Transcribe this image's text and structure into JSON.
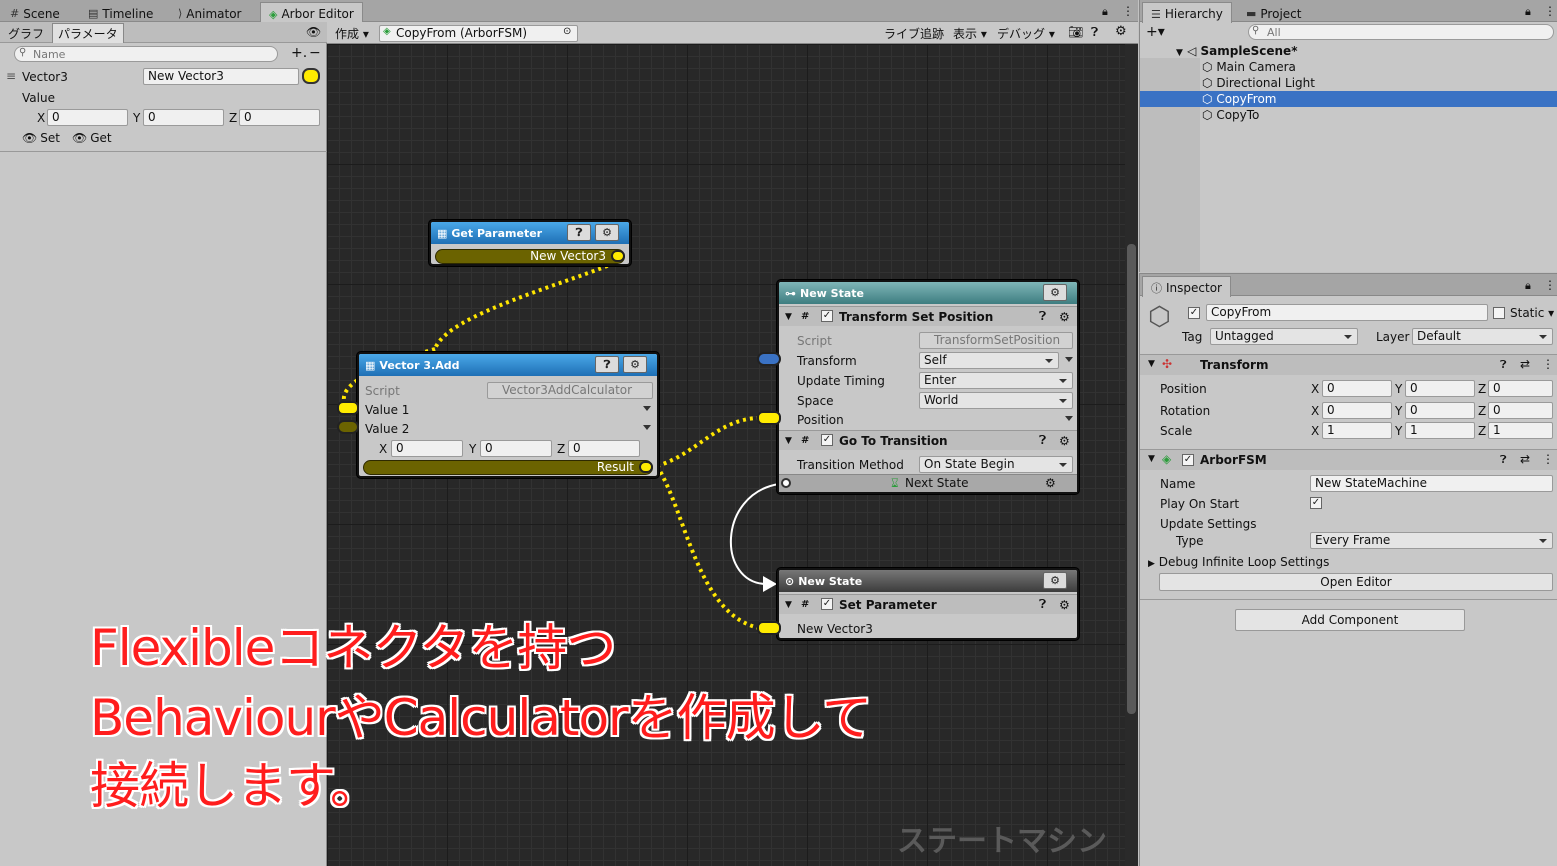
{
  "editor_tabs": [
    "Scene",
    "Timeline",
    "Animator",
    "Arbor Editor"
  ],
  "left_panel": {
    "sub_tabs": [
      "グラフ",
      "パラメータ"
    ],
    "search_placeholder": "Name",
    "param": {
      "type_label": "Vector3",
      "name_value": "New Vector3",
      "value_label": "Value",
      "x_label": "X",
      "x": "0",
      "y_label": "Y",
      "y": "0",
      "z_label": "Z",
      "z": "0"
    },
    "set_label": "Set",
    "get_label": "Get"
  },
  "graph_toolbar": {
    "create_label": "作成",
    "object_field": "CopyFrom (ArborFSM)",
    "live_tracking": "ライブ追跡",
    "view": "表示",
    "debug": "デバッグ"
  },
  "nodes": {
    "get_parameter": {
      "title": "Get Parameter",
      "output": "New Vector3"
    },
    "vector3_add": {
      "title": "Vector 3.Add",
      "script_label": "Script",
      "script_value": "Vector3AddCalculator",
      "value1": "Value 1",
      "value2": "Value 2",
      "x_label": "X",
      "x": "0",
      "y_label": "Y",
      "y": "0",
      "z_label": "Z",
      "z": "0",
      "result": "Result"
    },
    "state1": {
      "title": "New State",
      "behaviour1": {
        "title": "Transform Set Position",
        "script_label": "Script",
        "script_value": "TransformSetPosition",
        "transform_label": "Transform",
        "transform_value": "Self",
        "update_timing_label": "Update Timing",
        "update_timing_value": "Enter",
        "space_label": "Space",
        "space_value": "World",
        "position_label": "Position"
      },
      "behaviour2": {
        "title": "Go To Transition",
        "method_label": "Transition Method",
        "method_value": "On State Begin",
        "next_state": "Next State"
      }
    },
    "state2": {
      "title": "New State",
      "behaviour": {
        "title": "Set Parameter",
        "param": "New Vector3"
      }
    }
  },
  "watermark": "ステートマシン",
  "hierarchy": {
    "tabs": [
      "Hierarchy",
      "Project"
    ],
    "search_placeholder": "All",
    "scene": "SampleScene*",
    "items": [
      "Main Camera",
      "Directional Light",
      "CopyFrom",
      "CopyTo"
    ],
    "selected": "CopyFrom"
  },
  "inspector": {
    "tab": "Inspector",
    "object_name": "CopyFrom",
    "static_label": "Static",
    "tag_label": "Tag",
    "tag_value": "Untagged",
    "layer_label": "Layer",
    "layer_value": "Default",
    "transform": {
      "title": "Transform",
      "rows": [
        {
          "label": "Position",
          "x": "0",
          "y": "0",
          "z": "0"
        },
        {
          "label": "Rotation",
          "x": "0",
          "y": "0",
          "z": "0"
        },
        {
          "label": "Scale",
          "x": "1",
          "y": "1",
          "z": "1"
        }
      ]
    },
    "arbor": {
      "title": "ArborFSM",
      "name_label": "Name",
      "name_value": "New StateMachine",
      "play_label": "Play On Start",
      "update_label": "Update Settings",
      "type_label": "Type",
      "type_value": "Every Frame",
      "debug_label": "Debug Infinite Loop Settings",
      "open_editor": "Open Editor"
    },
    "add_component": "Add Component"
  },
  "overlay_lines": [
    "Flexibleコネクタを持つ",
    "BehaviourやCalculatorを作成して",
    "接続します。"
  ],
  "colors": {
    "accent_selected": "#3a72c4",
    "connection_yellow": "#ffe600",
    "overlay_red": "#ff1d1d"
  }
}
